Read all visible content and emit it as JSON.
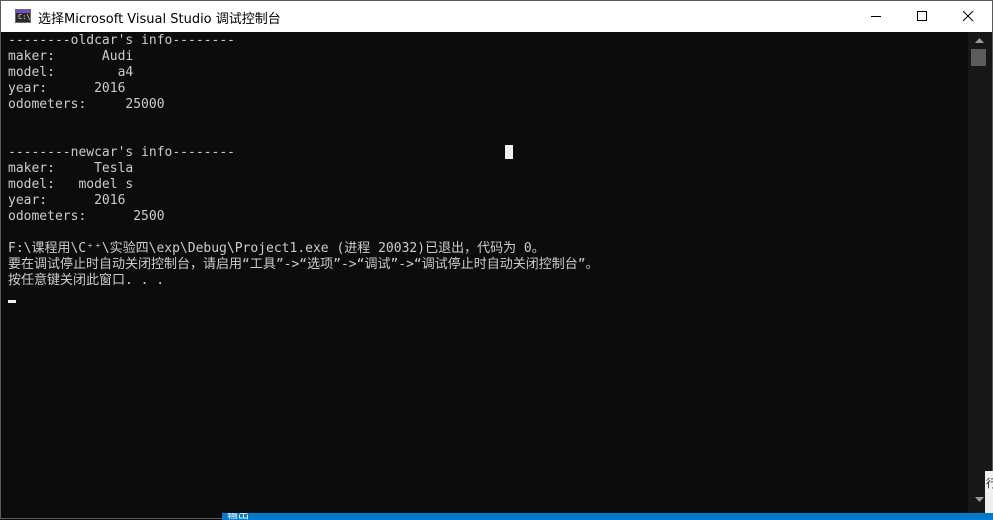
{
  "window": {
    "title": "选择Microsoft Visual Studio 调试控制台",
    "icon": "console-app-icon",
    "icon_glyph": "C:\\",
    "controls": [
      "minimize-icon",
      "maximize-icon",
      "close-icon"
    ]
  },
  "console": {
    "lines": [
      "--------oldcar's info--------",
      "maker:      Audi",
      "model:        a4",
      "year:      2016",
      "odometers:     25000",
      "",
      "",
      "--------newcar's info--------",
      "maker:     Tesla",
      "model:   model s",
      "year:      2016",
      "odometers:      2500",
      "",
      "F:\\课程用\\C⁺⁺\\实验四\\exp\\Debug\\Project1.exe (进程 20032)已退出，代码为 0。",
      "要在调试停止时自动关闭控制台，请启用“工具”->“选项”->“调试”->“调试停止时自动关闭控制台”。",
      "按任意键关闭此窗口. . ."
    ]
  },
  "background": {
    "right_peek_text": "行",
    "bottom_peek_text": "输出",
    "accent": "#007acc"
  },
  "colors": {
    "console_bg": "#0c0c0c",
    "console_text": "#cccccc",
    "titlebar_bg": "#ffffff"
  }
}
